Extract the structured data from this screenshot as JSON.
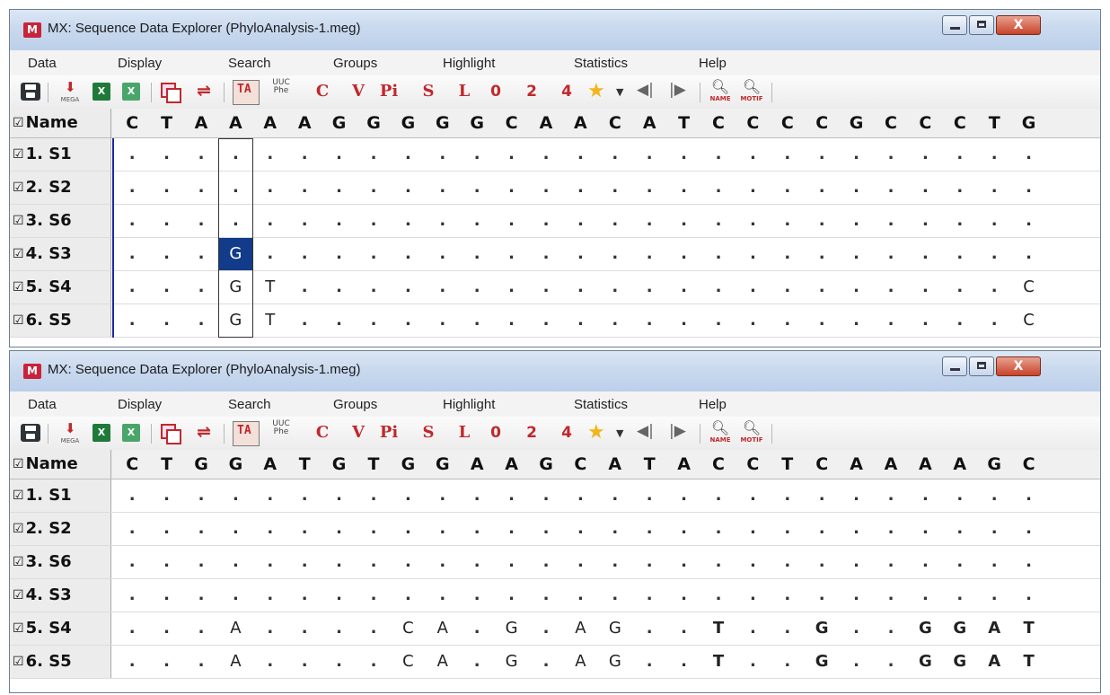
{
  "windows": [
    {
      "title": "MX: Sequence Data Explorer (PhyloAnalysis-1.meg)",
      "menu": [
        "Data",
        "Display",
        "Search",
        "Groups",
        "Highlight",
        "Statistics",
        "Help"
      ],
      "toolbar": {
        "export_label": "MEGA",
        "uuc_label": "UUC",
        "phe_label": "Phe",
        "ta_label": "TA",
        "letters": [
          "C",
          "V",
          "Pi",
          "S",
          "L"
        ],
        "numbers": [
          "0",
          "2",
          "4"
        ],
        "name_search": "NAME",
        "motif_search": "MOTIF",
        "xl": "X"
      },
      "header_label": "Name",
      "consensus": [
        "C",
        "T",
        "A",
        "A",
        "A",
        "A",
        "G",
        "G",
        "G",
        "G",
        "G",
        "C",
        "A",
        "A",
        "C",
        "A",
        "T",
        "C",
        "C",
        "C",
        "C",
        "G",
        "C",
        "C",
        "C",
        "T",
        "G"
      ],
      "rows": [
        {
          "name": "1. S1",
          "cells": [
            ".",
            ".",
            ".",
            ".",
            ".",
            ".",
            ".",
            ".",
            ".",
            ".",
            ".",
            ".",
            ".",
            ".",
            ".",
            ".",
            ".",
            ".",
            ".",
            ".",
            ".",
            ".",
            ".",
            ".",
            ".",
            ".",
            "."
          ]
        },
        {
          "name": "2. S2",
          "cells": [
            ".",
            ".",
            ".",
            ".",
            ".",
            ".",
            ".",
            ".",
            ".",
            ".",
            ".",
            ".",
            ".",
            ".",
            ".",
            ".",
            ".",
            ".",
            ".",
            ".",
            ".",
            ".",
            ".",
            ".",
            ".",
            ".",
            "."
          ]
        },
        {
          "name": "3. S6",
          "cells": [
            ".",
            ".",
            ".",
            ".",
            ".",
            ".",
            ".",
            ".",
            ".",
            ".",
            ".",
            ".",
            ".",
            ".",
            ".",
            ".",
            ".",
            ".",
            ".",
            ".",
            ".",
            ".",
            ".",
            ".",
            ".",
            ".",
            "."
          ]
        },
        {
          "name": "4. S3",
          "cells": [
            ".",
            ".",
            ".",
            "G",
            ".",
            ".",
            ".",
            ".",
            ".",
            ".",
            ".",
            ".",
            ".",
            ".",
            ".",
            ".",
            ".",
            ".",
            ".",
            ".",
            ".",
            ".",
            ".",
            ".",
            ".",
            ".",
            "."
          ]
        },
        {
          "name": "5. S4",
          "cells": [
            ".",
            ".",
            ".",
            "G",
            "T",
            ".",
            ".",
            ".",
            ".",
            ".",
            ".",
            ".",
            ".",
            ".",
            ".",
            ".",
            ".",
            ".",
            ".",
            ".",
            ".",
            ".",
            ".",
            ".",
            ".",
            ".",
            "C"
          ]
        },
        {
          "name": "6. S5",
          "cells": [
            ".",
            ".",
            ".",
            "G",
            "T",
            ".",
            ".",
            ".",
            ".",
            ".",
            ".",
            ".",
            ".",
            ".",
            ".",
            ".",
            ".",
            ".",
            ".",
            ".",
            ".",
            ".",
            ".",
            ".",
            ".",
            ".",
            "C"
          ]
        }
      ]
    },
    {
      "title": "MX: Sequence Data Explorer (PhyloAnalysis-1.meg)",
      "menu": [
        "Data",
        "Display",
        "Search",
        "Groups",
        "Highlight",
        "Statistics",
        "Help"
      ],
      "toolbar": {
        "export_label": "MEGA",
        "uuc_label": "UUC",
        "phe_label": "Phe",
        "ta_label": "TA",
        "letters": [
          "C",
          "V",
          "Pi",
          "S",
          "L"
        ],
        "numbers": [
          "0",
          "2",
          "4"
        ],
        "name_search": "NAME",
        "motif_search": "MOTIF",
        "xl": "X"
      },
      "header_label": "Name",
      "consensus": [
        "C",
        "T",
        "G",
        "G",
        "A",
        "T",
        "G",
        "T",
        "G",
        "G",
        "A",
        "A",
        "G",
        "C",
        "A",
        "T",
        "A",
        "C",
        "C",
        "T",
        "C",
        "A",
        "A",
        "A",
        "A",
        "G",
        "C"
      ],
      "rows": [
        {
          "name": "1. S1",
          "cells": [
            ".",
            ".",
            ".",
            ".",
            ".",
            ".",
            ".",
            ".",
            ".",
            ".",
            ".",
            ".",
            ".",
            ".",
            ".",
            ".",
            ".",
            ".",
            ".",
            ".",
            ".",
            ".",
            ".",
            ".",
            ".",
            ".",
            "."
          ]
        },
        {
          "name": "2. S2",
          "cells": [
            ".",
            ".",
            ".",
            ".",
            ".",
            ".",
            ".",
            ".",
            ".",
            ".",
            ".",
            ".",
            ".",
            ".",
            ".",
            ".",
            ".",
            ".",
            ".",
            ".",
            ".",
            ".",
            ".",
            ".",
            ".",
            ".",
            "."
          ]
        },
        {
          "name": "3. S6",
          "cells": [
            ".",
            ".",
            ".",
            ".",
            ".",
            ".",
            ".",
            ".",
            ".",
            ".",
            ".",
            ".",
            ".",
            ".",
            ".",
            ".",
            ".",
            ".",
            ".",
            ".",
            ".",
            ".",
            ".",
            ".",
            ".",
            ".",
            "."
          ]
        },
        {
          "name": "4. S3",
          "cells": [
            ".",
            ".",
            ".",
            ".",
            ".",
            ".",
            ".",
            ".",
            ".",
            ".",
            ".",
            ".",
            ".",
            ".",
            ".",
            ".",
            ".",
            ".",
            ".",
            ".",
            ".",
            ".",
            ".",
            ".",
            ".",
            ".",
            "."
          ]
        },
        {
          "name": "5. S4",
          "cells": [
            ".",
            ".",
            ".",
            "A",
            ".",
            ".",
            ".",
            ".",
            "C",
            "A",
            ".",
            "G",
            ".",
            "A",
            "G",
            ".",
            ".",
            "T",
            ".",
            ".",
            "G",
            ".",
            ".",
            "G",
            "G",
            "A",
            "T"
          ]
        },
        {
          "name": "6. S5",
          "cells": [
            ".",
            ".",
            ".",
            "A",
            ".",
            ".",
            ".",
            ".",
            "C",
            "A",
            ".",
            "G",
            ".",
            "A",
            "G",
            ".",
            ".",
            "T",
            ".",
            ".",
            "G",
            ".",
            ".",
            "G",
            "G",
            "A",
            "T"
          ]
        }
      ]
    }
  ]
}
